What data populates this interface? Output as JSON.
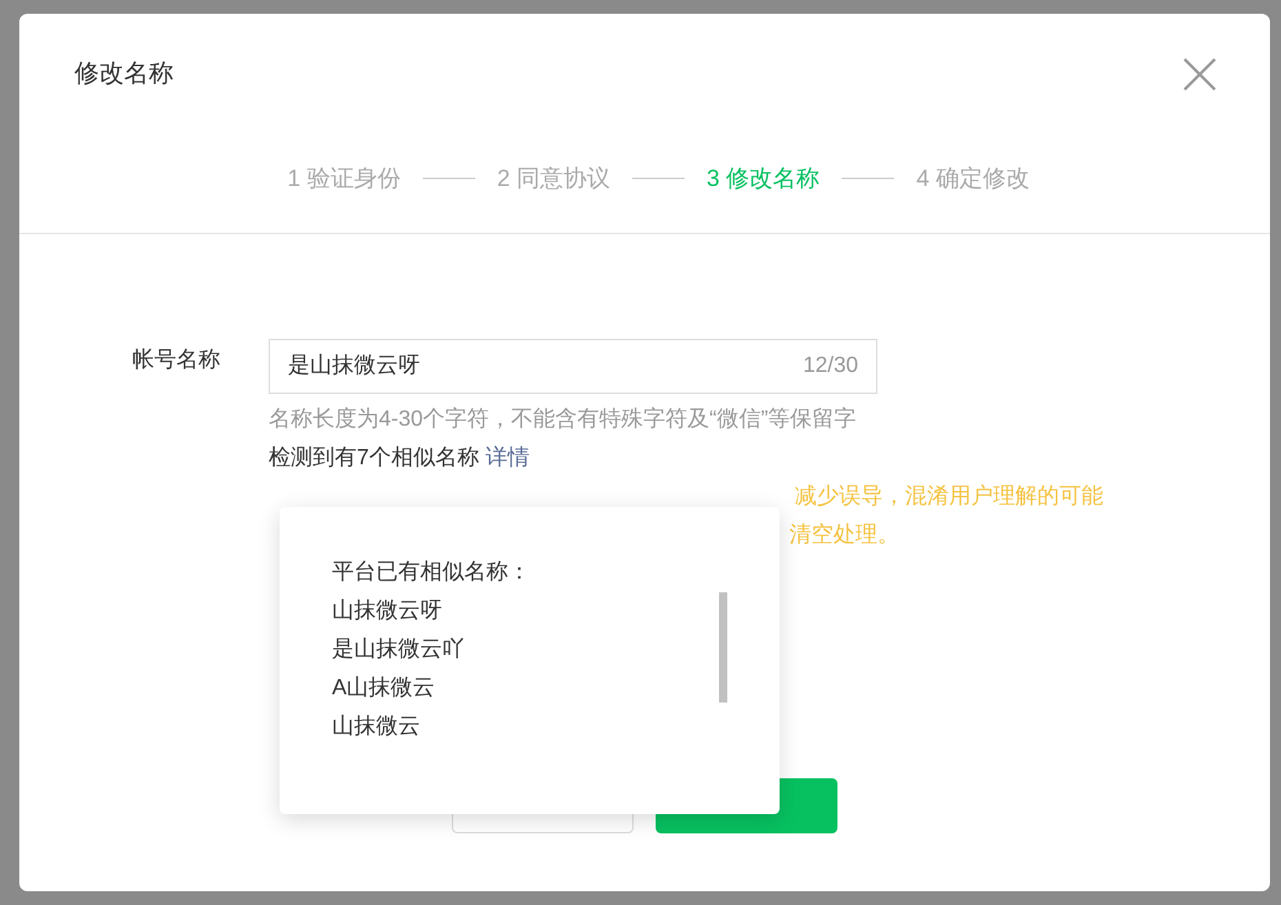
{
  "dialog": {
    "title": "修改名称",
    "steps": [
      {
        "label": "1 验证身份",
        "selected": false
      },
      {
        "label": "2 同意协议",
        "selected": false
      },
      {
        "label": "3 修改名称",
        "selected": true
      },
      {
        "label": "4 确定修改",
        "selected": false
      }
    ],
    "field": {
      "label": "帐号名称",
      "value": "是山抹微云呀",
      "counter": "12/30"
    },
    "hint": "名称长度为4-30个字符，不能含有特殊字符及“微信”等保留字",
    "similar": {
      "text": "检测到有7个相似名称",
      "link": "详情"
    },
    "warning": [
      "减少误导，混淆用户理解的可能",
      "清空处理。"
    ],
    "popup": {
      "title": "平台已有相似名称：",
      "items": [
        "山抹微云呀",
        "是山抹微云吖",
        "A山抹微云",
        "山抹微云"
      ]
    }
  }
}
